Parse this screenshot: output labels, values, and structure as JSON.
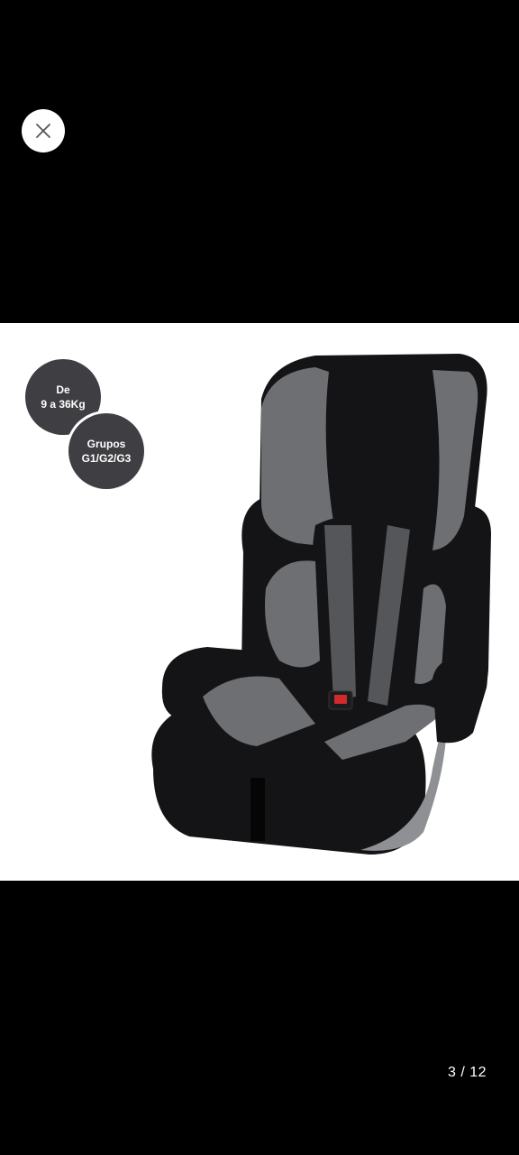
{
  "viewer": {
    "close_icon": "close-icon",
    "counter_text": "3 / 12"
  },
  "product_image": {
    "badge_weight": {
      "line1": "De",
      "line2": "9 a 36Kg"
    },
    "badge_groups": {
      "line1": "Grupos",
      "line2": "G1/G2/G3"
    },
    "colors": {
      "seat_black": "#141416",
      "seat_gray": "#6e6f73",
      "badge_bg": "#3f3f43",
      "buckle_red": "#d22a2a"
    }
  }
}
